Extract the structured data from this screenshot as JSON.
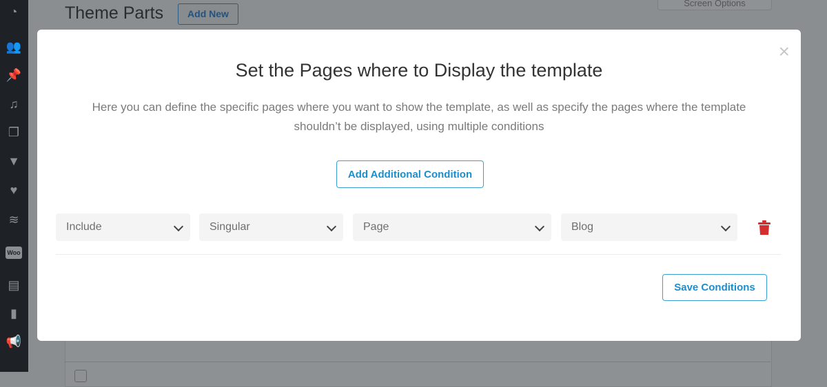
{
  "sidebar": {
    "icons": [
      "dashboard-icon",
      "users-icon",
      "pin-icon",
      "media-icon",
      "pages-icon",
      "comments-icon",
      "heart-icon",
      "layers-icon",
      "woo-icon",
      "archive-icon",
      "stats-icon",
      "megaphone-icon"
    ],
    "woo_label": "Woo"
  },
  "background": {
    "page_title": "Theme Parts",
    "add_new": "Add New",
    "screen_options": "Screen Options"
  },
  "modal": {
    "title": "Set the Pages where to Display the template",
    "description": "Here you can define the specific pages where you want to show the template, as well as specify the pages where the template shouldn’t be displayed, using multiple conditions",
    "add_condition": "Add Additional Condition",
    "condition": {
      "type": "Include",
      "group": "Singular",
      "post_type": "Page",
      "item": "Blog"
    },
    "save": "Save Conditions",
    "close": "×"
  },
  "colors": {
    "accent": "#1a8fce",
    "delete": "#d32f2f"
  }
}
